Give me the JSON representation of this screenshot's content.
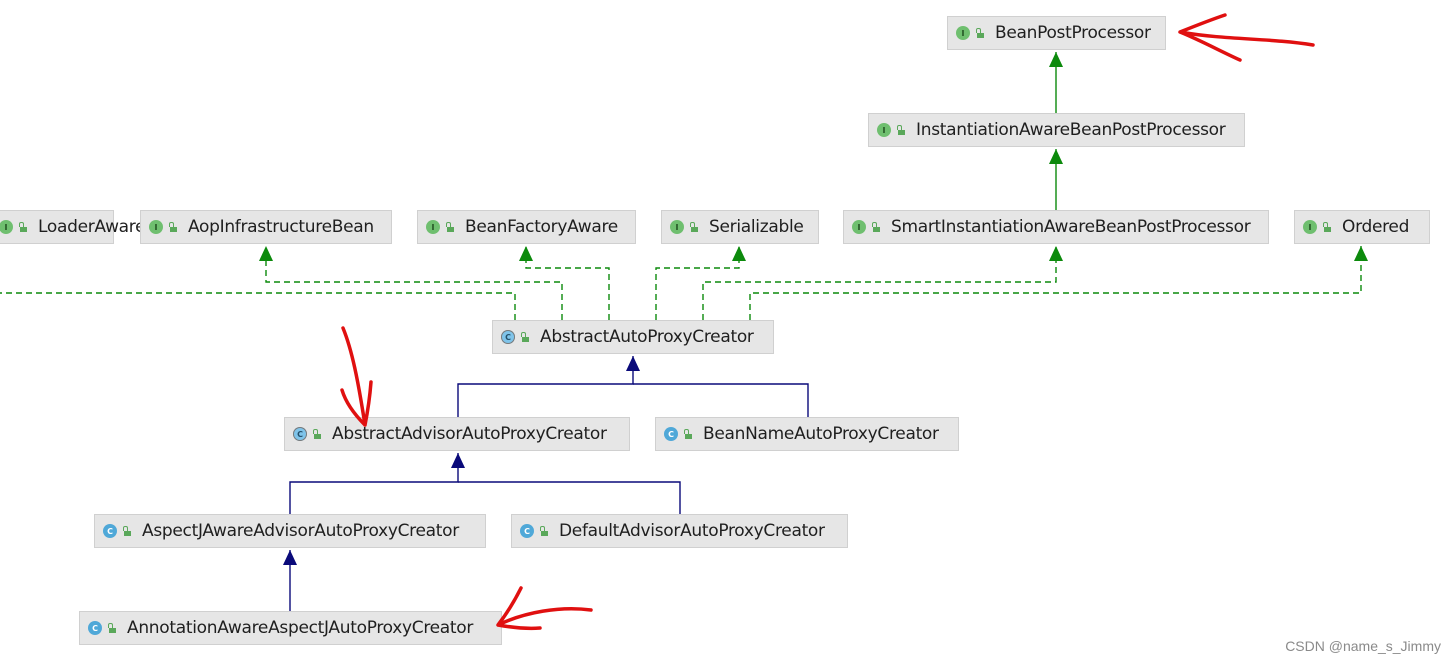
{
  "diagram": {
    "nodes": [
      {
        "id": "bpp",
        "label": "BeanPostProcessor",
        "kind": "interface",
        "kind_letter": "I"
      },
      {
        "id": "iabpp",
        "label": "InstantiationAwareBeanPostProcessor",
        "kind": "interface",
        "kind_letter": "I"
      },
      {
        "id": "bcla",
        "label": "LoaderAware",
        "kind": "interface",
        "kind_letter": "I"
      },
      {
        "id": "aib",
        "label": "AopInfrastructureBean",
        "kind": "interface",
        "kind_letter": "I"
      },
      {
        "id": "bfa",
        "label": "BeanFactoryAware",
        "kind": "interface",
        "kind_letter": "I"
      },
      {
        "id": "ser",
        "label": "Serializable",
        "kind": "interface",
        "kind_letter": "I"
      },
      {
        "id": "siabpp",
        "label": "SmartInstantiationAwareBeanPostProcessor",
        "kind": "interface",
        "kind_letter": "I"
      },
      {
        "id": "ord",
        "label": "Ordered",
        "kind": "interface",
        "kind_letter": "I"
      },
      {
        "id": "aapc",
        "label": "AbstractAutoProxyCreator",
        "kind": "abstract-class",
        "kind_letter": "C"
      },
      {
        "id": "aaapc",
        "label": "AbstractAdvisorAutoProxyCreator",
        "kind": "abstract-class",
        "kind_letter": "C"
      },
      {
        "id": "bnapc",
        "label": "BeanNameAutoProxyCreator",
        "kind": "class",
        "kind_letter": "C"
      },
      {
        "id": "ajaapc",
        "label": "AspectJAwareAdvisorAutoProxyCreator",
        "kind": "class",
        "kind_letter": "C"
      },
      {
        "id": "daapc",
        "label": "DefaultAdvisorAutoProxyCreator",
        "kind": "class",
        "kind_letter": "C"
      },
      {
        "id": "aaajapc",
        "label": "AnnotationAwareAspectJAutoProxyCreator",
        "kind": "class",
        "kind_letter": "C"
      }
    ],
    "edges": [
      {
        "from": "iabpp",
        "to": "bpp",
        "type": "extends-interface"
      },
      {
        "from": "siabpp",
        "to": "iabpp",
        "type": "extends-interface"
      },
      {
        "from": "aapc",
        "to": "bcla",
        "type": "implements"
      },
      {
        "from": "aapc",
        "to": "aib",
        "type": "implements"
      },
      {
        "from": "aapc",
        "to": "bfa",
        "type": "implements"
      },
      {
        "from": "aapc",
        "to": "ser",
        "type": "implements"
      },
      {
        "from": "aapc",
        "to": "siabpp",
        "type": "implements"
      },
      {
        "from": "aapc",
        "to": "ord",
        "type": "implements"
      },
      {
        "from": "aaapc",
        "to": "aapc",
        "type": "extends-class"
      },
      {
        "from": "bnapc",
        "to": "aapc",
        "type": "extends-class"
      },
      {
        "from": "ajaapc",
        "to": "aaapc",
        "type": "extends-class"
      },
      {
        "from": "daapc",
        "to": "aaapc",
        "type": "extends-class"
      },
      {
        "from": "aaajapc",
        "to": "ajaapc",
        "type": "extends-class"
      }
    ],
    "annotations": [
      {
        "id": "mark-bpp",
        "shape": "arrow-left",
        "target": "bpp"
      },
      {
        "id": "mark-aaapc",
        "shape": "arrow-down",
        "target": "aaapc"
      },
      {
        "id": "mark-aaajapc",
        "shape": "arrow-left",
        "target": "aaajapc"
      }
    ],
    "colors": {
      "interface_edge": "#0c8a0c",
      "class_edge": "#0a0a7a",
      "node_fill": "#e6e6e6",
      "node_border": "#d0d0d0",
      "annotation": "#e01010"
    }
  },
  "watermark": "CSDN @name_s_Jimmy"
}
